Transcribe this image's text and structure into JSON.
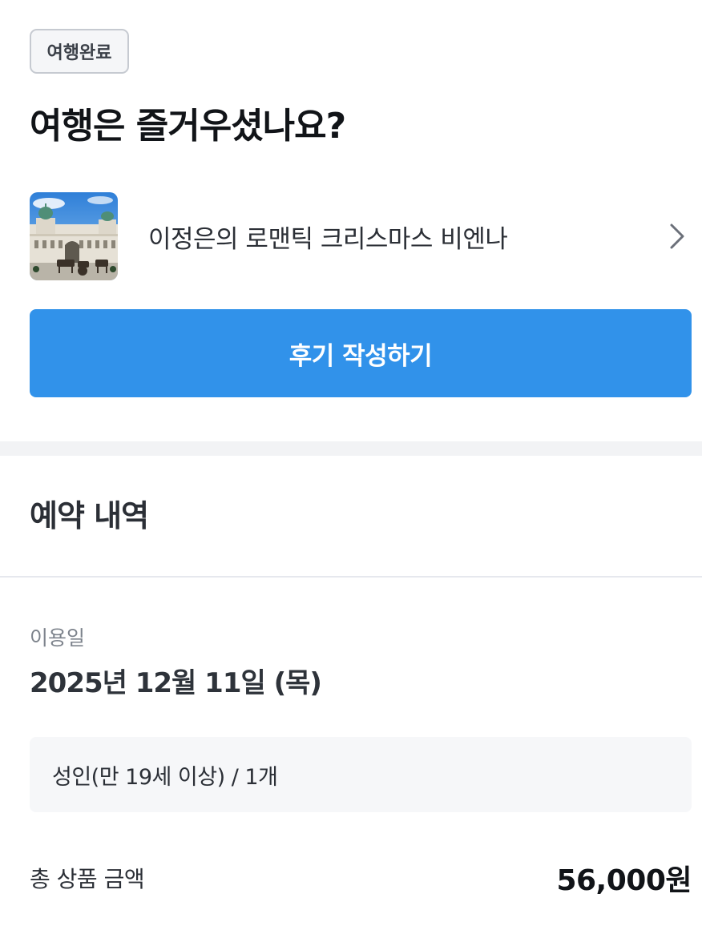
{
  "status_badge": "여행완료",
  "headline": "여행은 즐거우셨나요?",
  "product": {
    "title": "이정은의 로맨틱 크리스마스 비엔나",
    "thumbnail_icon": "vienna-palace-photo",
    "chevron_icon": "chevron-right-icon"
  },
  "review_button": "후기 작성하기",
  "reservation": {
    "section_title": "예약 내역",
    "use_date_label": "이용일",
    "use_date_value": "2025년 12월 11일 (목)",
    "option_text": "성인(만 19세 이상) / 1개",
    "total_label": "총 상품 금액",
    "total_amount": "56,000원"
  },
  "colors": {
    "accent": "#3192ea",
    "text_primary": "#111418",
    "text_secondary": "#7d838c",
    "section_bg": "#f2f3f5"
  }
}
